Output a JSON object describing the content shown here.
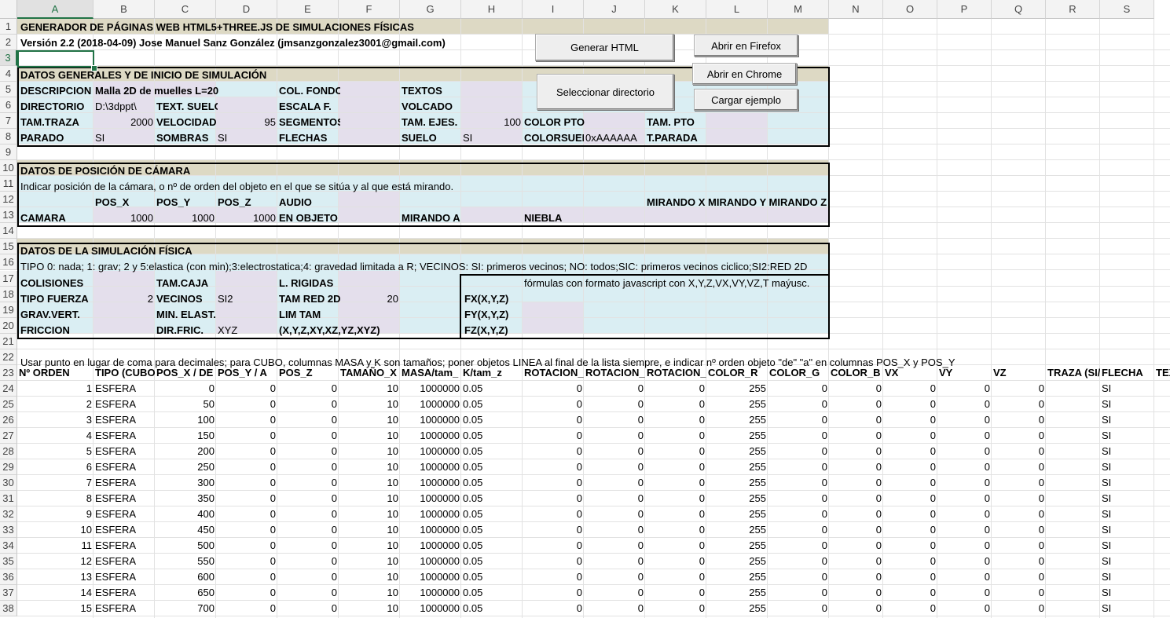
{
  "colors": {
    "title_band": "#ddd9c4",
    "light_blue": "#daeef3",
    "lilac": "#e4dfec",
    "grid": "#e2e2e2",
    "selection": "#217346"
  },
  "columns": [
    "A",
    "B",
    "C",
    "D",
    "E",
    "F",
    "G",
    "H",
    "I",
    "J",
    "K",
    "L",
    "M",
    "N",
    "O",
    "P",
    "Q",
    "R",
    "S"
  ],
  "rows_visible": [
    "1",
    "2",
    "3",
    "4",
    "5",
    "6",
    "7",
    "8",
    "9",
    "10",
    "11",
    "12",
    "13",
    "14",
    "15",
    "16",
    "17",
    "18",
    "19",
    "20",
    "21",
    "22",
    "23",
    "24",
    "25",
    "26",
    "27",
    "28",
    "29",
    "30",
    "31",
    "32",
    "33",
    "34",
    "35",
    "36",
    "37",
    "38"
  ],
  "buttons": {
    "generar_html": "Generar HTML",
    "abrir_firefox": "Abrir en Firefox",
    "abrir_chrome": "Abrir en Chrome",
    "seleccionar_directorio": "Seleccionar directorio",
    "cargar_ejemplo": "Cargar ejemplo"
  },
  "header": {
    "title": "GENERADOR DE PÁGINAS WEB HTML5+THREE.JS DE SIMULACIONES FÍSICAS",
    "version": "Versión 2.2 (2018-04-09) Jose Manuel Sanz González (jmsanzgonzalez3001@gmail.com)"
  },
  "general": {
    "section_title": "DATOS GENERALES Y DE INICIO DE SIMULACIÓN",
    "descripcion_label": "DESCRIPCION",
    "descripcion_value": "Malla 2D de muelles L=20",
    "col_fondo_label": "COL. FONDO",
    "textos_label": "TEXTOS",
    "directorio_label": "DIRECTORIO",
    "directorio_value": "D:\\3dppt\\",
    "text_suelo_label": "TEXT. SUELO",
    "escala_f_label": "ESCALA F.",
    "volcado_label": "VOLCADO",
    "tam_traza_label": "TAM.TRAZA",
    "tam_traza_value": "2000",
    "velocidad_label": "VELOCIDAD",
    "velocidad_value": "95",
    "segmentos_label": "SEGMENTOS",
    "tam_ejes_label": "TAM. EJES.",
    "tam_ejes_value": "100",
    "color_pto_label": "COLOR PTO",
    "tam_pto_label": "TAM. PTO",
    "parado_label": "PARADO",
    "parado_value": "SI",
    "sombras_label": "SOMBRAS",
    "sombras_value": "SI",
    "flechas_label": "FLECHAS",
    "suelo_label": "SUELO",
    "suelo_value": "SI",
    "colorsuelo_label": "COLORSUELO",
    "colorsuelo_value": "0xAAAAAA",
    "t_parada_label": "T.PARADA"
  },
  "camera": {
    "section_title": "DATOS DE POSICIÓN DE CÁMARA",
    "instruction": "Indicar posición de la cámara, o nº de orden del objeto en el que se sitúa y al que está mirando.",
    "pos_x_label": "POS_X",
    "pos_y_label": "POS_Y",
    "pos_z_label": "POS_Z",
    "audio_label": "AUDIO",
    "mirando_label": "MIRANDO X MIRANDO Y MIRANDO Z",
    "camara_label": "CAMARA",
    "pos_x": "1000",
    "pos_y": "1000",
    "pos_z": "1000",
    "en_objeto_label": "EN OBJETO",
    "mirando_a_label": "MIRANDO A",
    "niebla_label": "NIEBLA"
  },
  "physics": {
    "section_title": "DATOS DE LA SIMULACIÓN FÍSICA",
    "tipo_help": "TIPO 0: nada; 1: grav; 2 y 5:elastica (con min);3:electrostatica;4: gravedad limitada a R; VECINOS: SI: primeros vecinos; NO: todos;SIC: primeros vecinos ciclico;SI2:RED 2D",
    "colisiones_label": "COLISIONES",
    "tam_caja_label": "TAM.CAJA",
    "l_rigidas_label": "L. RIGIDAS",
    "formulas_note": "fórmulas con formato javascript con X,Y,Z,VX,VY,VZ,T maýusc.",
    "tipo_fuerza_label": "TIPO FUERZA",
    "tipo_fuerza_value": "2",
    "vecinos_label": "VECINOS",
    "vecinos_value": "SI2",
    "tam_red_2d_label": "TAM RED 2D",
    "tam_red_2d_value": "20",
    "fx_label": "FX(X,Y,Z)",
    "grav_vert_label": "GRAV.VERT.",
    "min_elast_label": "MIN. ELAST.",
    "lim_tam_label": "LIM TAM",
    "fy_label": "FY(X,Y,Z)",
    "friccion_label": "FRICCION",
    "dir_fric_label": "DIR.FRIC.",
    "dir_fric_value": "XYZ",
    "dir_fric_options": "(X,Y,Z,XY,XZ,YZ,XYZ)",
    "fz_label": "FZ(X,Y,Z)"
  },
  "objects_note": "Usar punto en lugar de coma para decimales; para CUBO, columnas MASA y K son tamaños; poner objetos LINEA al final de la lista siempre, e indicar nº orden objeto \"de\" \"a\" en columnas POS_X y POS_Y",
  "table": {
    "headers": [
      "Nº ORDEN",
      "TIPO (CUBO,",
      "POS_X / DE",
      "POS_Y / A",
      "POS_Z",
      "TAMAÑO_X",
      "MASA/tam_",
      "K/tam_z",
      "ROTACION_",
      "ROTACION_",
      "ROTACION_",
      "COLOR_R",
      "COLOR_G",
      "COLOR_B",
      "VX",
      "VY",
      "VZ",
      "TRAZA (SI/",
      "FLECHA",
      "TEX"
    ],
    "rows": [
      [
        "1",
        "ESFERA",
        "0",
        "0",
        "0",
        "10",
        "1000000",
        "0.05",
        "0",
        "0",
        "0",
        "255",
        "0",
        "0",
        "0",
        "0",
        "0",
        "",
        "SI"
      ],
      [
        "2",
        "ESFERA",
        "50",
        "0",
        "0",
        "10",
        "1000000",
        "0.05",
        "0",
        "0",
        "0",
        "255",
        "0",
        "0",
        "0",
        "0",
        "0",
        "",
        "SI"
      ],
      [
        "3",
        "ESFERA",
        "100",
        "0",
        "0",
        "10",
        "1000000",
        "0.05",
        "0",
        "0",
        "0",
        "255",
        "0",
        "0",
        "0",
        "0",
        "0",
        "",
        "SI"
      ],
      [
        "4",
        "ESFERA",
        "150",
        "0",
        "0",
        "10",
        "1000000",
        "0.05",
        "0",
        "0",
        "0",
        "255",
        "0",
        "0",
        "0",
        "0",
        "0",
        "",
        "SI"
      ],
      [
        "5",
        "ESFERA",
        "200",
        "0",
        "0",
        "10",
        "1000000",
        "0.05",
        "0",
        "0",
        "0",
        "255",
        "0",
        "0",
        "0",
        "0",
        "0",
        "",
        "SI"
      ],
      [
        "6",
        "ESFERA",
        "250",
        "0",
        "0",
        "10",
        "1000000",
        "0.05",
        "0",
        "0",
        "0",
        "255",
        "0",
        "0",
        "0",
        "0",
        "0",
        "",
        "SI"
      ],
      [
        "7",
        "ESFERA",
        "300",
        "0",
        "0",
        "10",
        "1000000",
        "0.05",
        "0",
        "0",
        "0",
        "255",
        "0",
        "0",
        "0",
        "0",
        "0",
        "",
        "SI"
      ],
      [
        "8",
        "ESFERA",
        "350",
        "0",
        "0",
        "10",
        "1000000",
        "0.05",
        "0",
        "0",
        "0",
        "255",
        "0",
        "0",
        "0",
        "0",
        "0",
        "",
        "SI"
      ],
      [
        "9",
        "ESFERA",
        "400",
        "0",
        "0",
        "10",
        "1000000",
        "0.05",
        "0",
        "0",
        "0",
        "255",
        "0",
        "0",
        "0",
        "0",
        "0",
        "",
        "SI"
      ],
      [
        "10",
        "ESFERA",
        "450",
        "0",
        "0",
        "10",
        "1000000",
        "0.05",
        "0",
        "0",
        "0",
        "255",
        "0",
        "0",
        "0",
        "0",
        "0",
        "",
        "SI"
      ],
      [
        "11",
        "ESFERA",
        "500",
        "0",
        "0",
        "10",
        "1000000",
        "0.05",
        "0",
        "0",
        "0",
        "255",
        "0",
        "0",
        "0",
        "0",
        "0",
        "",
        "SI"
      ],
      [
        "12",
        "ESFERA",
        "550",
        "0",
        "0",
        "10",
        "1000000",
        "0.05",
        "0",
        "0",
        "0",
        "255",
        "0",
        "0",
        "0",
        "0",
        "0",
        "",
        "SI"
      ],
      [
        "13",
        "ESFERA",
        "600",
        "0",
        "0",
        "10",
        "1000000",
        "0.05",
        "0",
        "0",
        "0",
        "255",
        "0",
        "0",
        "0",
        "0",
        "0",
        "",
        "SI"
      ],
      [
        "14",
        "ESFERA",
        "650",
        "0",
        "0",
        "10",
        "1000000",
        "0.05",
        "0",
        "0",
        "0",
        "255",
        "0",
        "0",
        "0",
        "0",
        "0",
        "",
        "SI"
      ],
      [
        "15",
        "ESFERA",
        "700",
        "0",
        "0",
        "10",
        "1000000",
        "0.05",
        "0",
        "0",
        "0",
        "255",
        "0",
        "0",
        "0",
        "0",
        "0",
        "",
        "SI"
      ]
    ]
  }
}
